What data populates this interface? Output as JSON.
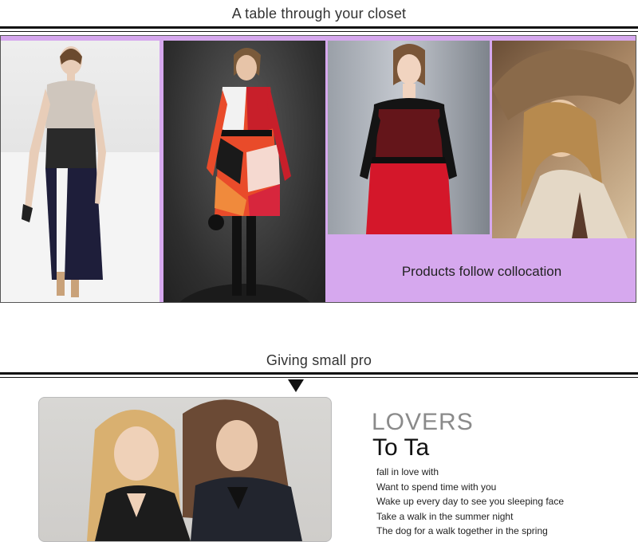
{
  "section1": {
    "title": "A table through your closet",
    "caption": "Products follow collocation",
    "accent_color": "#d6a8ee"
  },
  "section2": {
    "title": "Giving small pro",
    "heading": "LOVERS",
    "subheading": "To Ta",
    "lines": [
      "fall in love with",
      "Want to spend time with you",
      "Wake up every day to see you sleeping face",
      "Take a walk in the summer night",
      "The dog for a walk together in the spring"
    ]
  }
}
